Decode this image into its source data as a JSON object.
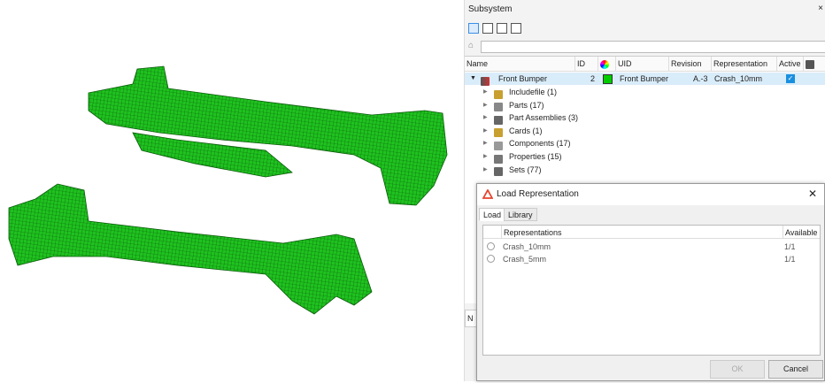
{
  "subsystem": {
    "title": "Subsystem",
    "close": "×",
    "search_placeholder": "",
    "columns": [
      "Name",
      "ID",
      "UID",
      "Revision",
      "Representation",
      "Active"
    ],
    "root": {
      "name": "Front Bumper",
      "id": "2",
      "color": "#00cc00",
      "uid": "Front Bumper",
      "revision": "A.-3",
      "representation": "Crash_10mm",
      "active": true
    },
    "children": [
      {
        "label": "Includefile (1)",
        "icon": "folder-icon",
        "color": "#c8a030"
      },
      {
        "label": "Parts (17)",
        "icon": "part-icon",
        "color": "#888888"
      },
      {
        "label": "Part Assemblies (3)",
        "icon": "assembly-icon",
        "color": "#666666"
      },
      {
        "label": "Cards (1)",
        "icon": "card-icon",
        "color": "#c8a030"
      },
      {
        "label": "Components (17)",
        "icon": "component-icon",
        "color": "#999999"
      },
      {
        "label": "Properties (15)",
        "icon": "property-icon",
        "color": "#777777"
      },
      {
        "label": "Sets (77)",
        "icon": "sets-icon",
        "color": "#666666"
      }
    ],
    "lower_label": "N"
  },
  "dialog": {
    "title": "Load Representation",
    "close": "✕",
    "tabs": [
      "Load",
      "Library"
    ],
    "columns": [
      "Representations",
      "Available"
    ],
    "rows": [
      {
        "name": "Crash_10mm",
        "available": "1/1"
      },
      {
        "name": "Crash_5mm",
        "available": "1/1"
      }
    ],
    "ok": "OK",
    "cancel": "Cancel",
    "accent": "#e8432d"
  }
}
